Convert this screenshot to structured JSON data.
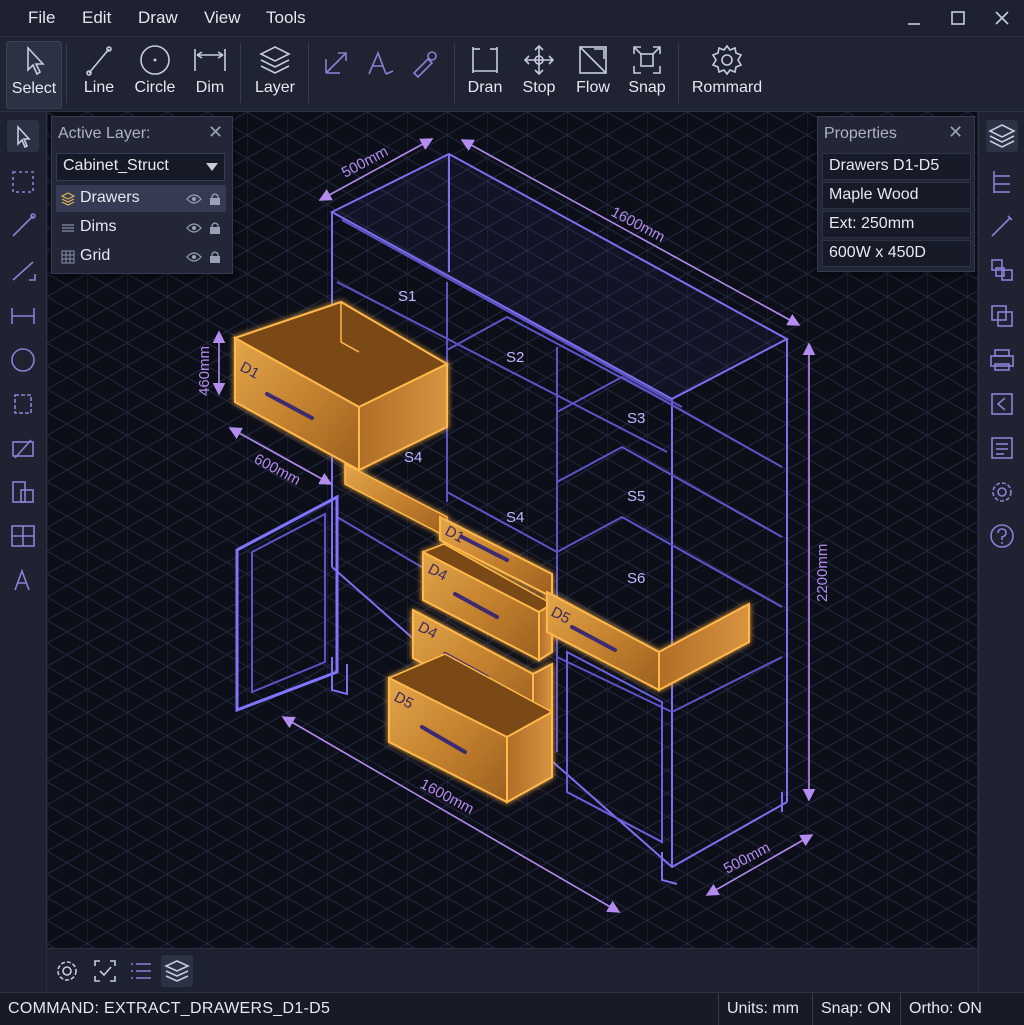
{
  "menu": [
    "File",
    "Edit",
    "Draw",
    "View",
    "Tools"
  ],
  "toolbar": {
    "tools": [
      {
        "label": "Select",
        "icon": "cursor-icon"
      },
      {
        "label": "Line",
        "icon": "line-icon"
      },
      {
        "label": "Circle",
        "icon": "circle-icon"
      },
      {
        "label": "Dim",
        "icon": "dimension-icon"
      },
      {
        "label": "Layer",
        "icon": "layers-icon"
      },
      {
        "label": "Dran",
        "icon": "draw-frame-icon"
      },
      {
        "label": "Stop",
        "icon": "move-arrows-icon"
      },
      {
        "label": "Flow",
        "icon": "flow-square-icon"
      },
      {
        "label": "Snap",
        "icon": "snap-expand-icon"
      },
      {
        "label": "Rommard",
        "icon": "gear-icon"
      }
    ],
    "unlabeled_icons": [
      "diagonal-arrow-icon",
      "text-angle-icon",
      "pen-nib-icon"
    ]
  },
  "layers_panel": {
    "title": "Active Layer:",
    "current_layer": "Cabinet_Struct",
    "layers": [
      {
        "name": "Drawers",
        "active": true
      },
      {
        "name": "Dims",
        "active": false
      },
      {
        "name": "Grid",
        "active": false
      }
    ]
  },
  "properties_panel": {
    "title": "Properties",
    "rows": [
      "Drawers D1-D5",
      "Maple Wood",
      "Ext: 250mm",
      "600W x 450D"
    ]
  },
  "drawing": {
    "dims": {
      "top_depth": "500mm",
      "top_width": "1600mm",
      "drawer_height": "460mm",
      "drawer_depth": "600mm",
      "height": "2200mm",
      "bottom_width": "1600mm",
      "bottom_depth": "500mm"
    },
    "shelves": [
      "S1",
      "S2",
      "S3",
      "S4",
      "S4",
      "S5",
      "S6"
    ],
    "drawers": [
      "D1",
      "D1",
      "D4",
      "D4",
      "D5",
      "D5"
    ]
  },
  "status": {
    "command": "COMMAND: EXTRACT_DRAWERS_D1-D5",
    "units": "Units: mm",
    "snap": "Snap: ON",
    "ortho": "Ortho: ON"
  },
  "colors": {
    "accent": "#8e7fd6",
    "wireframe": "#7c6ff0",
    "dimension": "#b48cf0",
    "wood": "#c98a35",
    "glow": "#ffb84a",
    "background": "#0c0e18"
  }
}
